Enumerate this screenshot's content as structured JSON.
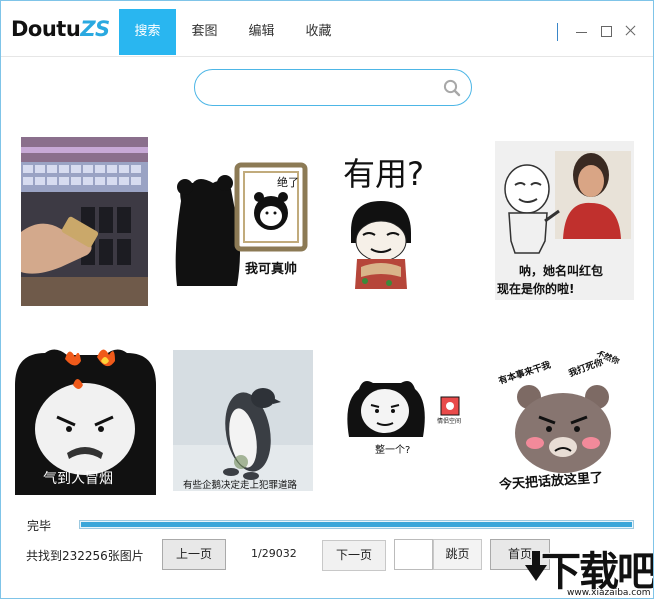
{
  "app": {
    "logo_text": "Doutu",
    "logo_accent": "ZS"
  },
  "tabs": [
    {
      "label": "搜索",
      "active": true
    },
    {
      "label": "套图",
      "active": false
    },
    {
      "label": "编辑",
      "active": false
    },
    {
      "label": "收藏",
      "active": false
    }
  ],
  "search": {
    "value": "",
    "placeholder": ""
  },
  "images": [
    {
      "caption": ""
    },
    {
      "caption": "我可真帅",
      "frame_text": "绝了"
    },
    {
      "caption": "",
      "top_text": "有用?"
    },
    {
      "caption": "呐，她名叫红包",
      "caption2": "现在是你的啦!"
    },
    {
      "caption": "气到人冒烟"
    },
    {
      "caption": "有些企鹅决定走上犯罪道路"
    },
    {
      "caption": "整一个?",
      "badge_text": "情侣空间"
    },
    {
      "caption": "今天把话放这里了",
      "side_text1": "有本事来干我",
      "side_text2": "我打死你",
      "side_text3": "不然你"
    }
  ],
  "status": {
    "label": "完毕",
    "progress": 1.0
  },
  "pagination": {
    "found_text": "共找到232256张图片",
    "prev_label": "上一页",
    "page_text": "1/29032",
    "next_label": "下一页",
    "jump_value": "",
    "jump_label": "跳页",
    "first_label": "首页"
  },
  "watermark": {
    "main": "下载吧",
    "sub": "www.xiazaiba.com"
  },
  "colors": {
    "accent": "#29b6f0",
    "border": "#7fc4e8",
    "progress": "#3aa6d9"
  }
}
